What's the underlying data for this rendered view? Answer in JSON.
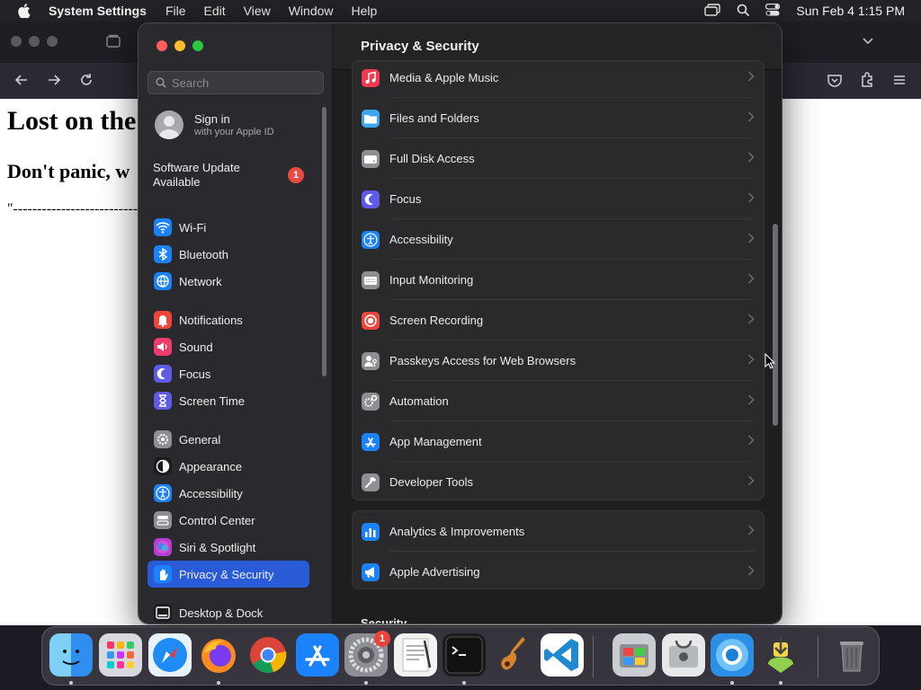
{
  "menubar": {
    "app_name": "System Settings",
    "menus": [
      "File",
      "Edit",
      "View",
      "Window",
      "Help"
    ],
    "clock": "Sun Feb 4  1:15 PM",
    "icons": [
      "apple-icon",
      "screen-mirroring-icon",
      "spotlight-search-icon",
      "control-center-icon"
    ]
  },
  "browser": {
    "page_heading": "Lost on the",
    "page_subheading": "Don't panic, w",
    "page_dashes": "\"-------------------------------"
  },
  "settings": {
    "search_placeholder": "Search",
    "signin": {
      "title": "Sign in",
      "subtitle": "with your Apple ID"
    },
    "software_update": {
      "label": "Software Update Available",
      "badge": "1"
    },
    "sidebar_items": [
      {
        "label": "Wi-Fi",
        "icon": "wifi-icon",
        "color": "#1a82fb"
      },
      {
        "label": "Bluetooth",
        "icon": "bluetooth-icon",
        "color": "#1a82fb"
      },
      {
        "label": "Network",
        "icon": "globe-icon",
        "color": "#1a82fb"
      },
      {
        "label": "Notifications",
        "icon": "bell-icon",
        "color": "#f0453a"
      },
      {
        "label": "Sound",
        "icon": "speaker-icon",
        "color": "#ec3d6c"
      },
      {
        "label": "Focus",
        "icon": "moon-icon",
        "color": "#5e5ce6"
      },
      {
        "label": "Screen Time",
        "icon": "hourglass-icon",
        "color": "#5e5ce6"
      },
      {
        "label": "General",
        "icon": "gear-icon",
        "color": "#8e8e93"
      },
      {
        "label": "Appearance",
        "icon": "appearance-icon",
        "color": "#1c1c1e"
      },
      {
        "label": "Accessibility",
        "icon": "accessibility-icon",
        "color": "#1a82fb"
      },
      {
        "label": "Control Center",
        "icon": "control-center-icon",
        "color": "#8e8e93"
      },
      {
        "label": "Siri & Spotlight",
        "icon": "siri-icon",
        "color": "#b23fd1"
      },
      {
        "label": "Privacy & Security",
        "icon": "hand-icon",
        "color": "#1a82fb"
      },
      {
        "label": "Desktop & Dock",
        "icon": "dock-icon",
        "color": "#1c1c1e"
      }
    ],
    "selected_item": "Privacy & Security",
    "main_title": "Privacy & Security",
    "group1": [
      {
        "label": "Media & Apple Music",
        "icon": "music-icon",
        "color": "#f2394f"
      },
      {
        "label": "Files and Folders",
        "icon": "folder-icon",
        "color": "#3aa7f0"
      },
      {
        "label": "Full Disk Access",
        "icon": "disk-icon",
        "color": "#8e8e93"
      },
      {
        "label": "Focus",
        "icon": "moon-icon",
        "color": "#5e5ce6"
      },
      {
        "label": "Accessibility",
        "icon": "accessibility-icon",
        "color": "#1a82fb"
      },
      {
        "label": "Input Monitoring",
        "icon": "keyboard-icon",
        "color": "#8e8e93"
      },
      {
        "label": "Screen Recording",
        "icon": "record-icon",
        "color": "#f0453a"
      },
      {
        "label": "Passkeys Access for Web Browsers",
        "icon": "passkey-icon",
        "color": "#8e8e93"
      },
      {
        "label": "Automation",
        "icon": "gears-icon",
        "color": "#8e8e93"
      },
      {
        "label": "App Management",
        "icon": "app-store-icon",
        "color": "#1a82fb"
      },
      {
        "label": "Developer Tools",
        "icon": "hammer-icon",
        "color": "#8e8e93"
      }
    ],
    "group2": [
      {
        "label": "Analytics & Improvements",
        "icon": "chart-icon",
        "color": "#1a82fb"
      },
      {
        "label": "Apple Advertising",
        "icon": "megaphone-icon",
        "color": "#1a82fb"
      }
    ],
    "section_label": "Security"
  },
  "dock": {
    "apps": [
      {
        "name": "Finder",
        "icon": "finder-icon",
        "running": true
      },
      {
        "name": "Launchpad",
        "icon": "launchpad-icon",
        "running": false
      },
      {
        "name": "Safari",
        "icon": "safari-icon",
        "running": false
      },
      {
        "name": "Firefox",
        "icon": "firefox-icon",
        "running": true
      },
      {
        "name": "Chrome",
        "icon": "chrome-icon",
        "running": false
      },
      {
        "name": "App Store",
        "icon": "app-store-icon",
        "running": false
      },
      {
        "name": "System Settings",
        "icon": "system-settings-icon",
        "running": true,
        "badge": "1"
      },
      {
        "name": "TextEdit",
        "icon": "textedit-icon",
        "running": false
      },
      {
        "name": "Terminal",
        "icon": "terminal-icon",
        "running": true
      },
      {
        "name": "GarageBand",
        "icon": "guitar-icon",
        "running": false
      },
      {
        "name": "VS Code",
        "icon": "vscode-icon",
        "running": false
      },
      {
        "name": "Boot Camp Assistant",
        "icon": "bootcamp-icon",
        "running": false
      },
      {
        "name": "Disk Utility",
        "icon": "disk-utility-icon",
        "running": false
      },
      {
        "name": "Screen Sharing",
        "icon": "screen-sharing-icon",
        "running": true
      },
      {
        "name": "Installer",
        "icon": "installer-icon",
        "running": true
      },
      {
        "name": "Trash",
        "icon": "trash-icon",
        "running": false
      }
    ]
  }
}
